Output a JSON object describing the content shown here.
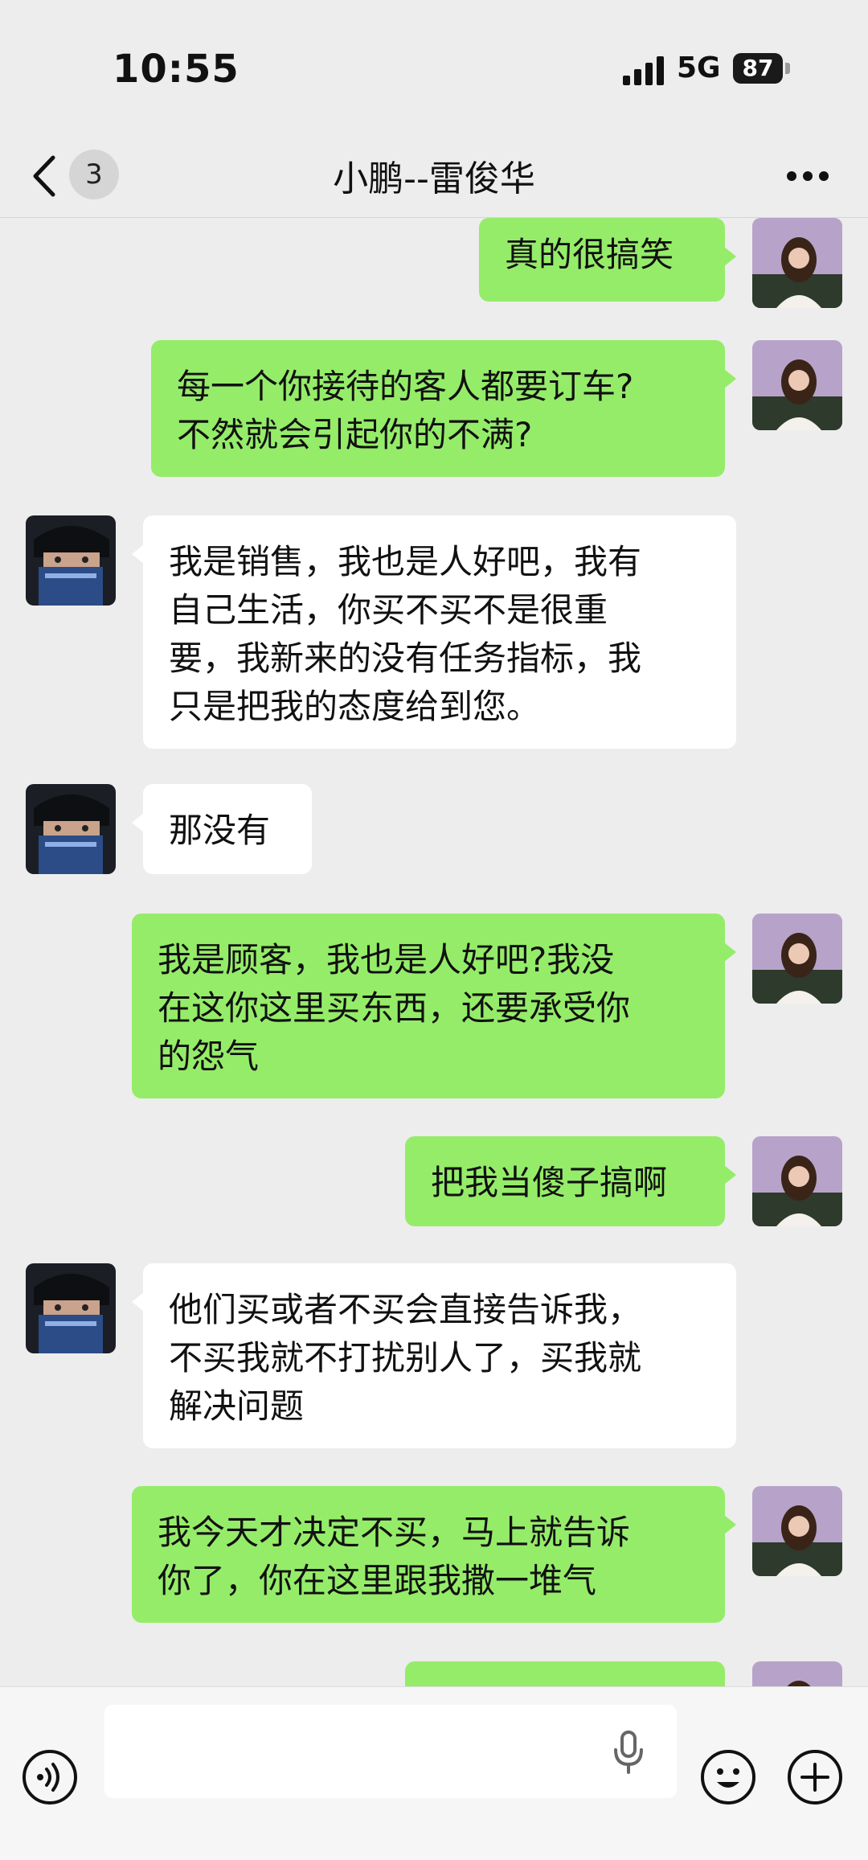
{
  "status_bar": {
    "time": "10:55",
    "network": "5G",
    "battery": "87"
  },
  "nav": {
    "unread_count": "3",
    "title": "小鹏--雷俊华"
  },
  "messages": [
    {
      "side": "right",
      "text": "真的很搞笑"
    },
    {
      "side": "right",
      "text": "每一个你接待的客人都要订车?\n不然就会引起你的不满?"
    },
    {
      "side": "left",
      "text": "我是销售，我也是人好吧，我有\n自己生活，你买不买不是很重\n要，我新来的没有任务指标，我\n只是把我的态度给到您。"
    },
    {
      "side": "left",
      "text": "那没有"
    },
    {
      "side": "right",
      "text": "我是顾客，我也是人好吧?我没\n在这你这里买东西，还要承受你\n的怨气"
    },
    {
      "side": "right",
      "text": "把我当傻子搞啊"
    },
    {
      "side": "left",
      "text": "他们买或者不买会直接告诉我，\n不买我就不打扰别人了，买我就\n解决问题"
    },
    {
      "side": "right",
      "text": "我今天才决定不买，马上就告诉\n你了，你在这里跟我撒一堆气"
    },
    {
      "side": "right",
      "text": ""
    }
  ],
  "icons": {
    "back": "chevron-left-icon",
    "more": "ellipsis-icon",
    "voice": "voice-icon",
    "mic": "microphone-icon",
    "emoji": "emoji-icon",
    "plus": "plus-icon"
  },
  "colors": {
    "sent_bubble": "#95ec69",
    "received_bubble": "#ffffff",
    "background": "#ededed"
  }
}
